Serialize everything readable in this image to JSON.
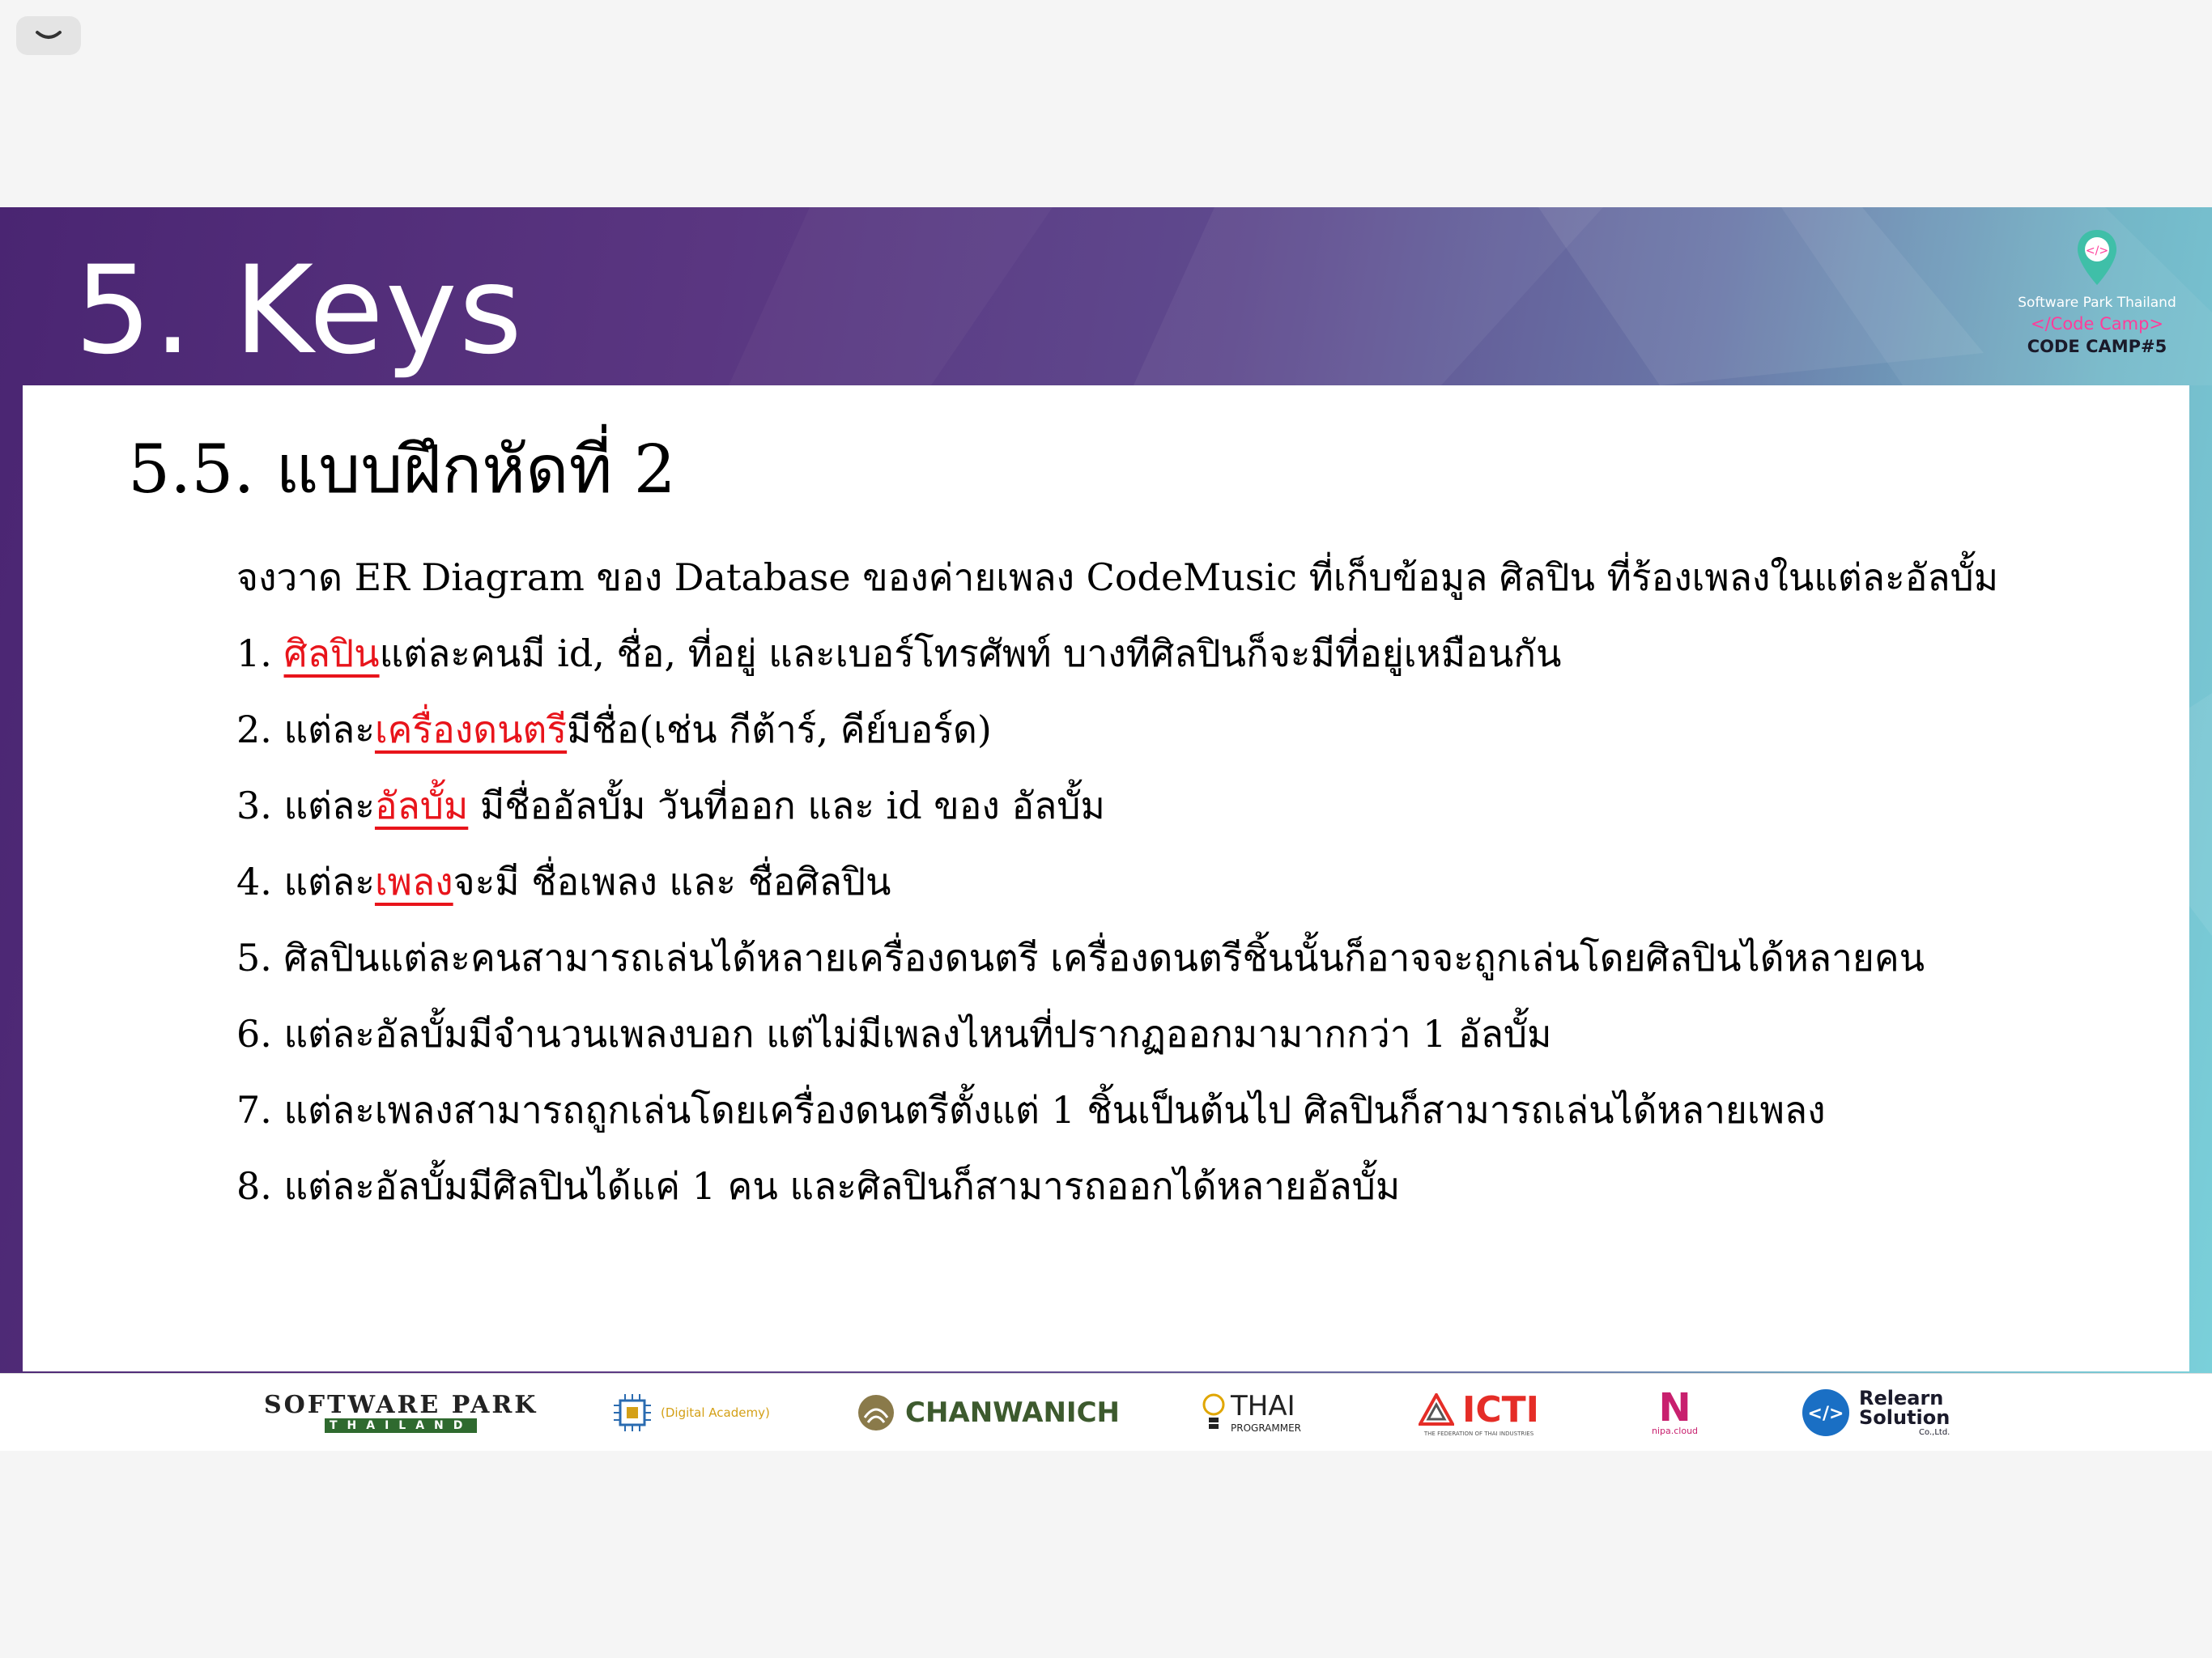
{
  "viewer": {
    "collapse_icon": "chevron-down-icon"
  },
  "slide": {
    "title": "5. Keys",
    "brand": {
      "line1": "Software Park Thailand",
      "line2": "</Code Camp>",
      "line3": "CODE CAMP#5",
      "icon": "location-pin-code-icon"
    },
    "heading": "5.5. แบบฝึกหัดที่ 2",
    "intro": "จงวาด ER Diagram ของ Database ของค่ายเพลง CodeMusic ที่เก็บข้อมูล ศิลปิน ที่ร้องเพลงในแต่ละอัลบั้ม",
    "items": [
      {
        "prefix": "1. ",
        "keyword": "ศิลปิน",
        "text": "แต่ละคนมี id, ชื่อ, ที่อยู่ และเบอร์โทรศัพท์ บางทีศิลปินก็จะมีที่อยู่เหมือนกัน"
      },
      {
        "prefix": "2. แต่ละ",
        "keyword": "เครื่องดนตรี",
        "text": "มีชื่อ(เช่น กีต้าร์, คีย์บอร์ด)"
      },
      {
        "prefix": "3. แต่ละ",
        "keyword": "อัลบั้ม",
        "text": " มีชื่ออัลบั้ม วันที่ออก และ id ของ อัลบั้ม"
      },
      {
        "prefix": "4. แต่ละ",
        "keyword": "เพลง",
        "text": "จะมี ชื่อเพลง และ ชื่อศิลปิน"
      },
      {
        "text": "5. ศิลปินแต่ละคนสามารถเล่นได้หลายเครื่องดนตรี เครื่องดนตรีชิ้นนั้นก็อาจจะถูกเล่นโดยศิลปินได้หลายคน"
      },
      {
        "text": "6. แต่ละอัลบั้มมีจำนวนเพลงบอก แต่ไม่มีเพลงไหนที่ปรากฏออกมามากกว่า 1 อัลบั้ม"
      },
      {
        "text": "7. แต่ละเพลงสามารถถูกเล่นโดยเครื่องดนตรีตั้งแต่ 1 ชิ้นเป็นต้นไป ศิลปินก็สามารถเล่นได้หลายเพลง"
      },
      {
        "text": "8. แต่ละอัลบั้มมีศิลปินได้แค่ 1 คน และศิลปินก็สามารถออกได้หลายอัลบั้ม"
      }
    ],
    "colors": {
      "keyword": "#e8141b",
      "band_start": "#4a2572",
      "band_end": "#7ad0da"
    }
  },
  "sponsors": {
    "software_park": {
      "top": "SOFTWARE PARK",
      "bottom": "THAILAND"
    },
    "digital_academy": {
      "text": "(Digital Academy)"
    },
    "chanwanich": {
      "text": "CHANWANICH"
    },
    "thai_programmer": {
      "main": "THAI",
      "sub": "PROGRAMMER"
    },
    "icti": {
      "main": "ICTI",
      "sub": "THE FEDERATION OF THAI INDUSTRIES"
    },
    "nipa": {
      "mark": "N",
      "text": "nipa.cloud"
    },
    "relearn": {
      "main1": "Relearn",
      "main2": "Solution",
      "sub": "Co.,Ltd."
    }
  }
}
